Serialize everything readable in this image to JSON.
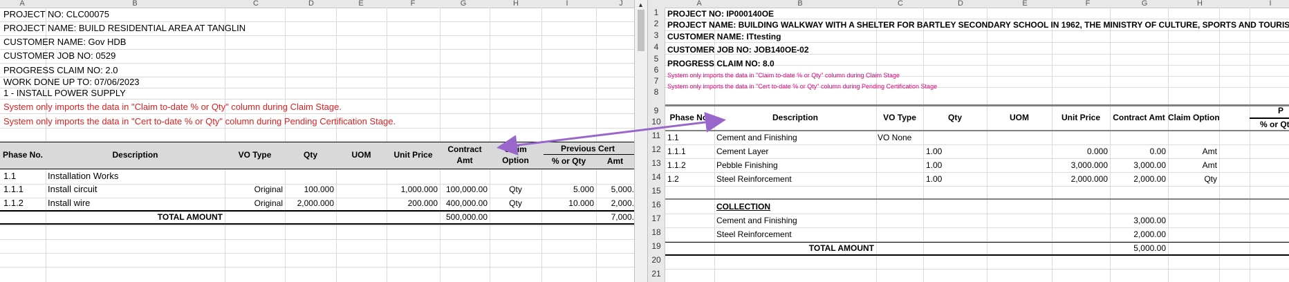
{
  "left": {
    "col_headers": [
      "A",
      "B",
      "C",
      "D",
      "E",
      "F",
      "G",
      "H",
      "I",
      "J"
    ],
    "info_lines": [
      "PROJECT NO: CLC00075",
      "PROJECT NAME: BUILD RESIDENTIAL AREA AT TANGLIN",
      "CUSTOMER NAME: Gov HDB",
      "CUSTOMER JOB NO: 0529",
      "PROGRESS CLAIM NO: 2.0",
      "WORK DONE UP TO: 07/06/2023",
      "1 - INSTALL POWER SUPPLY"
    ],
    "notes": [
      "System only imports the data in \"Claim to-date % or Qty\" column during Claim Stage.",
      "System only imports the data in \"Cert to-date % or Qty\" column during Pending Certification Stage."
    ],
    "table_headers": {
      "phase": "Phase No.",
      "desc": "Description",
      "vo": "VO Type",
      "qty": "Qty",
      "uom": "UOM",
      "unit_price": "Unit Price",
      "contract_amt_1": "Contract",
      "contract_amt_2": "Amt",
      "claim_option_1": "Claim",
      "claim_option_2": "Option",
      "prev_cert": "Previous Cert",
      "pct_qty": "% or Qty",
      "amt": "Amt"
    },
    "rows": [
      {
        "phase": "1.1",
        "desc": "Installation Works",
        "vo": "",
        "qty": "",
        "uom": "",
        "unit_price": "",
        "contract_amt": "",
        "claim_option": "",
        "pct": "",
        "amt": ""
      },
      {
        "phase": "1.1.1",
        "desc": "Install circuit",
        "vo": "Original",
        "qty": "100.000",
        "uom": "",
        "unit_price": "1,000.000",
        "contract_amt": "100,000.00",
        "claim_option": "Qty",
        "pct": "5.000",
        "amt": "5,000."
      },
      {
        "phase": "1.1.2",
        "desc": "Install wire",
        "vo": "Original",
        "qty": "2,000.000",
        "uom": "",
        "unit_price": "200.000",
        "contract_amt": "400,000.00",
        "claim_option": "Qty",
        "pct": "10.000",
        "amt": "2,000."
      }
    ],
    "total_label": "TOTAL AMOUNT",
    "total_contract": "500,000.00",
    "total_amt": "7,000."
  },
  "right": {
    "col_headers": [
      "A",
      "B",
      "C",
      "D",
      "E",
      "F",
      "G",
      "H",
      "I"
    ],
    "row_numbers": [
      "1",
      "2",
      "3",
      "4",
      "5",
      "6",
      "7",
      "8",
      "9",
      "10",
      "11",
      "12",
      "13",
      "14",
      "15",
      "16",
      "17",
      "18",
      "19",
      "20",
      "21"
    ],
    "info_lines": [
      "PROJECT NO: IP000140OE",
      "PROJECT NAME: BUILDING WALKWAY WITH A SHELTER FOR BARTLEY SECONDARY SCHOOL IN 1962, THE MINISTRY OF CULTURE, SPORTS AND TOURISM OF NOR",
      "CUSTOMER NAME: ITtesting",
      "CUSTOMER JOB NO: JOB140OE-02",
      "PROGRESS CLAIM NO: 8.0"
    ],
    "notes": [
      "System only imports the data in \"Claim to-date % or Qty\" column during Claim Stage",
      "System only imports the data in \"Cert to-date % or Qty\" column during Pending Certification Stage"
    ],
    "table_headers": {
      "phase": "Phase No.",
      "desc": "Description",
      "vo": "VO Type",
      "qty": "Qty",
      "uom": "UOM",
      "unit_price": "Unit Price",
      "contract_amt": "Contract Amt",
      "claim_option": "Claim Option",
      "prev_top": "P",
      "prev_sub": "% or Qt"
    },
    "rows": [
      {
        "phase": "1.1",
        "desc": "Cement and Finishing",
        "vo": "VO None",
        "qty": "",
        "unit_price": "",
        "contract_amt": "",
        "claim_option": ""
      },
      {
        "phase": "1.1.1",
        "desc": "Cement Layer",
        "vo": "",
        "qty": "1.00",
        "unit_price": "0.000",
        "contract_amt": "0.00",
        "claim_option": "Amt"
      },
      {
        "phase": "1.1.2",
        "desc": "Pebble Finishing",
        "vo": "",
        "qty": "1.00",
        "unit_price": "3,000.000",
        "contract_amt": "3,000.00",
        "claim_option": "Amt"
      },
      {
        "phase": "1.2",
        "desc": "Steel Reinforcement",
        "vo": "",
        "qty": "1.00",
        "unit_price": "2,000.000",
        "contract_amt": "2,000.00",
        "claim_option": "Qty"
      }
    ],
    "collection_label": "COLLECTION",
    "collection": [
      {
        "desc": "Cement and Finishing",
        "amt": "3,000.00"
      },
      {
        "desc": "Steel Reinforcement",
        "amt": "2,000.00"
      }
    ],
    "total_label": "TOTAL AMOUNT",
    "total_amt": "5,000.00"
  },
  "colors": {
    "note_red": "#e02020",
    "note_magenta": "#e0007a",
    "arrow": "#9966cc",
    "header_band": "#d9d9d9"
  }
}
